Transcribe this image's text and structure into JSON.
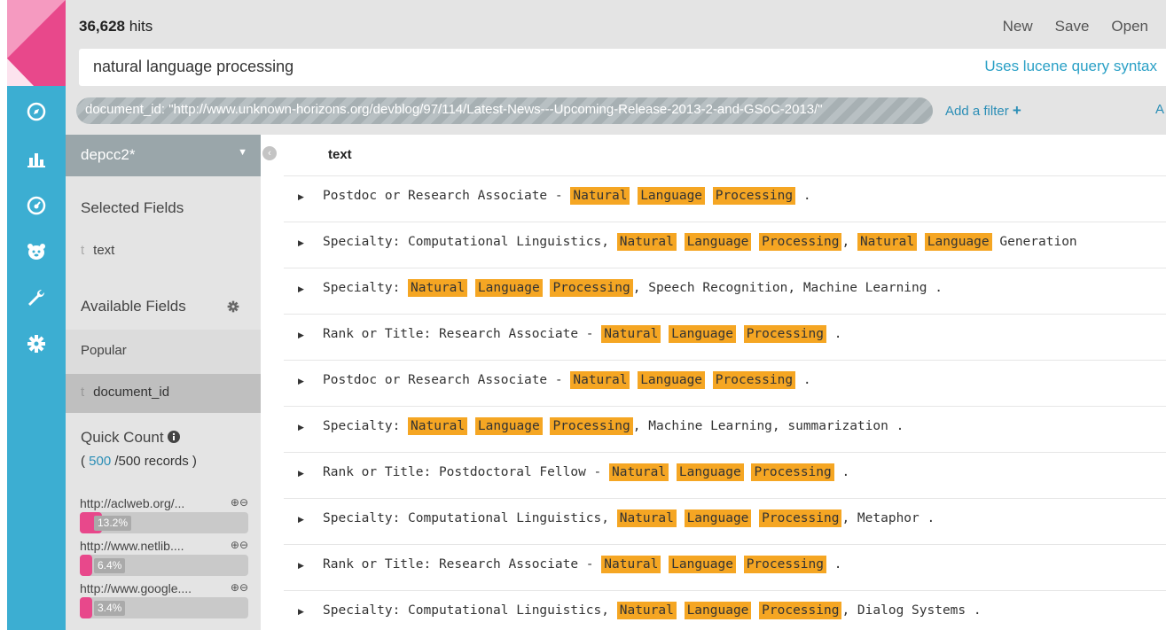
{
  "header": {
    "hits_count": "36,628",
    "hits_label": "hits",
    "menu": [
      "New",
      "Save",
      "Open"
    ],
    "query": "natural language processing",
    "query_hint": "Uses lucene query syntax"
  },
  "filter": {
    "pill_text": "document_id: \"http://www.unknown-horizons.org/devblog/97/114/Latest-News---Upcoming-Release-2013-2-and-GSoC-2013/\"",
    "add_filter": "Add a filter",
    "add_icon": "+",
    "edge_text": "A"
  },
  "sidebar": {
    "index_pattern": "depcc2*",
    "selected_fields_title": "Selected Fields",
    "selected_fields": [
      {
        "type": "t",
        "name": "text"
      }
    ],
    "available_fields_title": "Available Fields",
    "popular_label": "Popular",
    "popular_fields": [
      {
        "type": "t",
        "name": "document_id"
      }
    ],
    "quick_count_title": "Quick Count",
    "records_open": "(",
    "records_shown": "500",
    "records_total": "/500 records )",
    "quick_items": [
      {
        "label": "http://aclweb.org/...",
        "pct_label": "13.2%",
        "fraction": 0.132
      },
      {
        "label": "http://www.netlib....",
        "pct_label": "6.4%",
        "fraction": 0.064
      },
      {
        "label": "http://www.google....",
        "pct_label": "3.4%",
        "fraction": 0.034
      }
    ]
  },
  "results": {
    "column": "text",
    "rows": [
      [
        {
          "t": "Postdoc or Research Associate - "
        },
        {
          "t": "Natural",
          "h": 1
        },
        {
          "t": " "
        },
        {
          "t": "Language",
          "h": 1
        },
        {
          "t": " "
        },
        {
          "t": "Processing",
          "h": 1
        },
        {
          "t": " ."
        }
      ],
      [
        {
          "t": "Specialty: Computational Linguistics, "
        },
        {
          "t": "Natural",
          "h": 1
        },
        {
          "t": " "
        },
        {
          "t": "Language",
          "h": 1
        },
        {
          "t": " "
        },
        {
          "t": "Processing",
          "h": 1
        },
        {
          "t": ", "
        },
        {
          "t": "Natural",
          "h": 1
        },
        {
          "t": " "
        },
        {
          "t": "Language",
          "h": 1
        },
        {
          "t": " Generation"
        }
      ],
      [
        {
          "t": "Specialty: "
        },
        {
          "t": "Natural",
          "h": 1
        },
        {
          "t": " "
        },
        {
          "t": "Language",
          "h": 1
        },
        {
          "t": " "
        },
        {
          "t": "Processing",
          "h": 1
        },
        {
          "t": ", Speech Recognition, Machine Learning ."
        }
      ],
      [
        {
          "t": "Rank or Title: Research Associate - "
        },
        {
          "t": "Natural",
          "h": 1
        },
        {
          "t": " "
        },
        {
          "t": "Language",
          "h": 1
        },
        {
          "t": " "
        },
        {
          "t": "Processing",
          "h": 1
        },
        {
          "t": " ."
        }
      ],
      [
        {
          "t": "Postdoc or Research Associate - "
        },
        {
          "t": "Natural",
          "h": 1
        },
        {
          "t": " "
        },
        {
          "t": "Language",
          "h": 1
        },
        {
          "t": " "
        },
        {
          "t": "Processing",
          "h": 1
        },
        {
          "t": " ."
        }
      ],
      [
        {
          "t": "Specialty: "
        },
        {
          "t": "Natural",
          "h": 1
        },
        {
          "t": " "
        },
        {
          "t": "Language",
          "h": 1
        },
        {
          "t": " "
        },
        {
          "t": "Processing",
          "h": 1
        },
        {
          "t": ", Machine Learning, summarization ."
        }
      ],
      [
        {
          "t": "Rank or Title: Postdoctoral Fellow - "
        },
        {
          "t": "Natural",
          "h": 1
        },
        {
          "t": " "
        },
        {
          "t": "Language",
          "h": 1
        },
        {
          "t": " "
        },
        {
          "t": "Processing",
          "h": 1
        },
        {
          "t": " ."
        }
      ],
      [
        {
          "t": "Specialty: Computational Linguistics, "
        },
        {
          "t": "Natural",
          "h": 1
        },
        {
          "t": " "
        },
        {
          "t": "Language",
          "h": 1
        },
        {
          "t": " "
        },
        {
          "t": "Processing",
          "h": 1
        },
        {
          "t": ", Metaphor ."
        }
      ],
      [
        {
          "t": "Rank or Title: Research Associate - "
        },
        {
          "t": "Natural",
          "h": 1
        },
        {
          "t": " "
        },
        {
          "t": "Language",
          "h": 1
        },
        {
          "t": " "
        },
        {
          "t": "Processing",
          "h": 1
        },
        {
          "t": " ."
        }
      ],
      [
        {
          "t": "Specialty: Computational Linguistics, "
        },
        {
          "t": "Natural",
          "h": 1
        },
        {
          "t": " "
        },
        {
          "t": "Language",
          "h": 1
        },
        {
          "t": " "
        },
        {
          "t": "Processing",
          "h": 1
        },
        {
          "t": ", Dialog Systems ."
        }
      ]
    ]
  },
  "nav": {
    "items": [
      "compass-icon",
      "bar-chart-icon",
      "dashboard-icon",
      "bear-icon",
      "wrench-icon",
      "gear-icon"
    ]
  },
  "colors": {
    "nav": "#3caed2",
    "brand": "#e8488b",
    "highlight": "#f5a623",
    "link": "#2b8eb6"
  }
}
